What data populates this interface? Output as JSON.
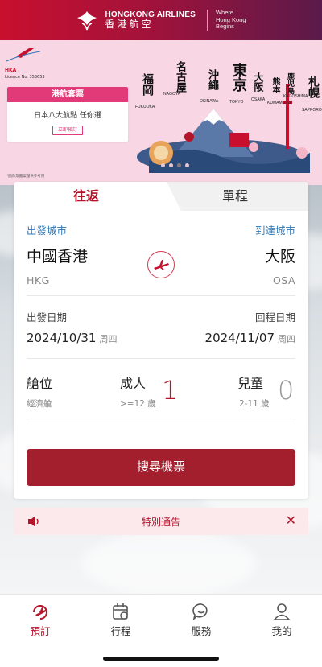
{
  "header": {
    "brand_en": "HONGKONG AIRLINES",
    "brand_zh": "香港航空",
    "tagline_1": "Where",
    "tagline_2": "Hong Kong",
    "tagline_3": "Begins"
  },
  "banner": {
    "badge_line1": "HKA",
    "badge_line2": "Licence No. 353653",
    "promo_title": "港航套票",
    "promo_subtitle": "日本八大航點 任你選",
    "promo_button": "立即預訂",
    "disclaimer": "*圖像及圖案僅供參考用",
    "cities": [
      "福岡",
      "名古屋",
      "沖繩",
      "東京",
      "大阪",
      "熊本",
      "鹿児島",
      "札幌"
    ],
    "cities_en": [
      "FUKUOKA",
      "NAGOYA",
      "OKINAWA",
      "TOKYO",
      "OSAKA",
      "KUMAMOTO",
      "KAGOSHIMA",
      "SAPPORO"
    ],
    "slide_count": 4,
    "active_slide": 2
  },
  "booking": {
    "tab_round_trip": "往返",
    "tab_one_way": "單程",
    "origin_label": "出發城市",
    "destination_label": "到達城市",
    "origin_city": "中國香港",
    "origin_code": "HKG",
    "destination_city": "大阪",
    "destination_code": "OSA",
    "depart_label": "出發日期",
    "return_label": "回程日期",
    "depart_date": "2024/10/31",
    "depart_weekday": "周四",
    "return_date": "2024/11/07",
    "return_weekday": "周四",
    "cabin_label": "艙位",
    "cabin_value": "經濟艙",
    "adult_label": "成人",
    "adult_note": ">=12 歲",
    "adult_count": "1",
    "child_label": "兒童",
    "child_note": "2-11 歲",
    "child_count": "0",
    "search_button": "搜尋機票"
  },
  "notice": {
    "text": "特別通告"
  },
  "nav": {
    "items": [
      {
        "label": "預訂",
        "icon": "booking-icon"
      },
      {
        "label": "行程",
        "icon": "calendar-icon"
      },
      {
        "label": "服務",
        "icon": "chat-icon"
      },
      {
        "label": "我的",
        "icon": "user-icon"
      }
    ]
  },
  "colors": {
    "brand_red": "#a41f2d",
    "accent_red": "#b5152b",
    "link_blue": "#2e77b5",
    "banner_pink": "#f8d6e3"
  }
}
